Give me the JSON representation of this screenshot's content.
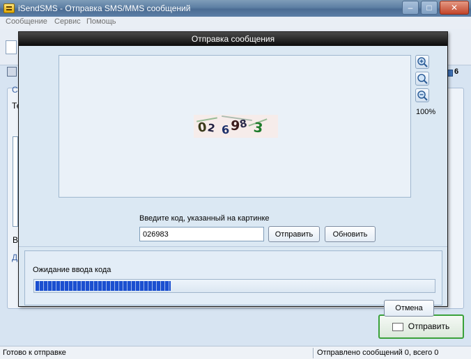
{
  "window": {
    "title": "iSendSMS - Отправка SMS/MMS сообщений"
  },
  "menu": [
    {
      "label": "Сообщение"
    },
    {
      "label": "Сервис"
    },
    {
      "label": "Помощь"
    }
  ],
  "background": {
    "side_count": "6",
    "fragment_tc": "Те",
    "fragment_b": "В",
    "fragment_d": "Д",
    "fragment_c": "С",
    "send_button_label": "Отправить"
  },
  "status_bar": {
    "left": "Готово к отправке",
    "right": "Отправлено сообщений 0, всего 0"
  },
  "dialog": {
    "title": "Отправка сообщения",
    "captcha_digits": [
      "0",
      "2",
      "6",
      "9",
      "8",
      "3"
    ],
    "zoom_level": "100%",
    "code_label": "Введите код, указанный на картинке",
    "code_value": "026983",
    "send_label": "Отправить",
    "refresh_label": "Обновить",
    "progress_label": "Ожидание ввода кода",
    "progress_fraction": 0.34,
    "cancel_label": "Отмена"
  },
  "colors": {
    "dialog_title_bg": "#0b0b0b",
    "progress_fill": "#1b4fd0",
    "send_button_border": "#3aa13a"
  }
}
